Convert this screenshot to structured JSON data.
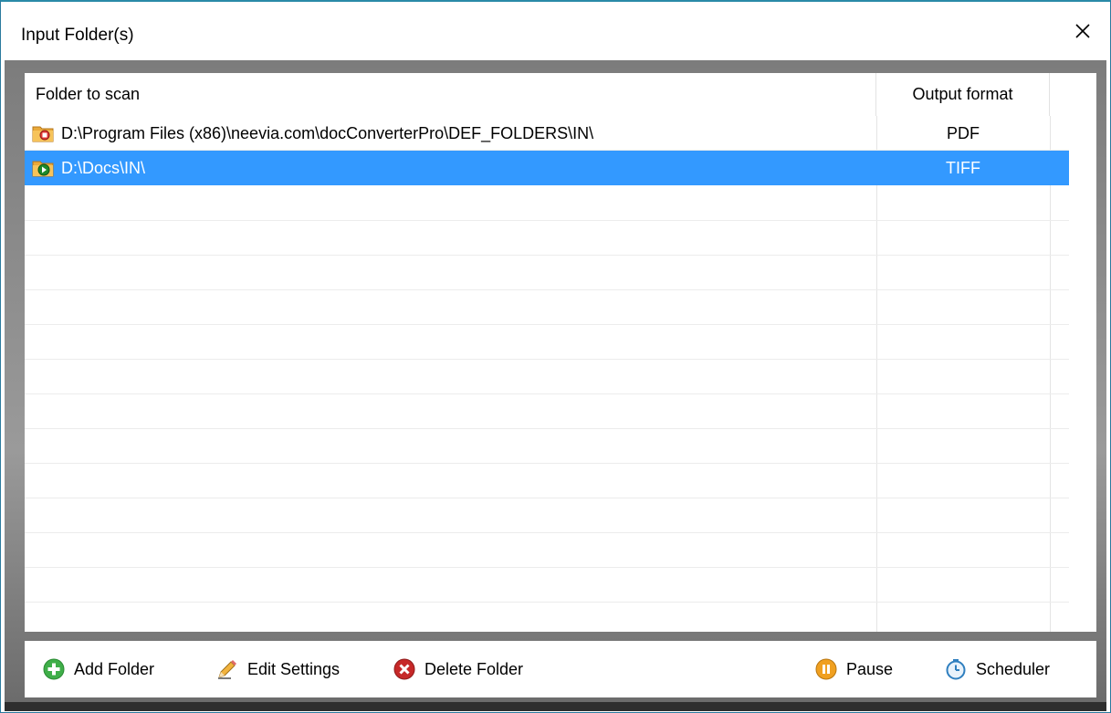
{
  "window": {
    "title": "Input Folder(s)"
  },
  "list": {
    "columns": {
      "folder": "Folder to scan",
      "format": "Output format"
    },
    "rows": [
      {
        "folder": "D:\\Program Files (x86)\\neevia.com\\docConverterPro\\DEF_FOLDERS\\IN\\",
        "format": "PDF",
        "selected": false,
        "status_icon": "folder-stopped-icon"
      },
      {
        "folder": "D:\\Docs\\IN\\",
        "format": "TIFF",
        "selected": true,
        "status_icon": "folder-running-icon"
      }
    ]
  },
  "toolbar": {
    "add": "Add Folder",
    "edit": "Edit Settings",
    "delete": "Delete Folder",
    "pause": "Pause",
    "scheduler": "Scheduler"
  },
  "colors": {
    "selection": "#3399ff",
    "add_icon": "#3fae49",
    "delete_icon": "#c62828",
    "pause_icon": "#f0a020",
    "scheduler_icon": "#2f7fbf"
  }
}
